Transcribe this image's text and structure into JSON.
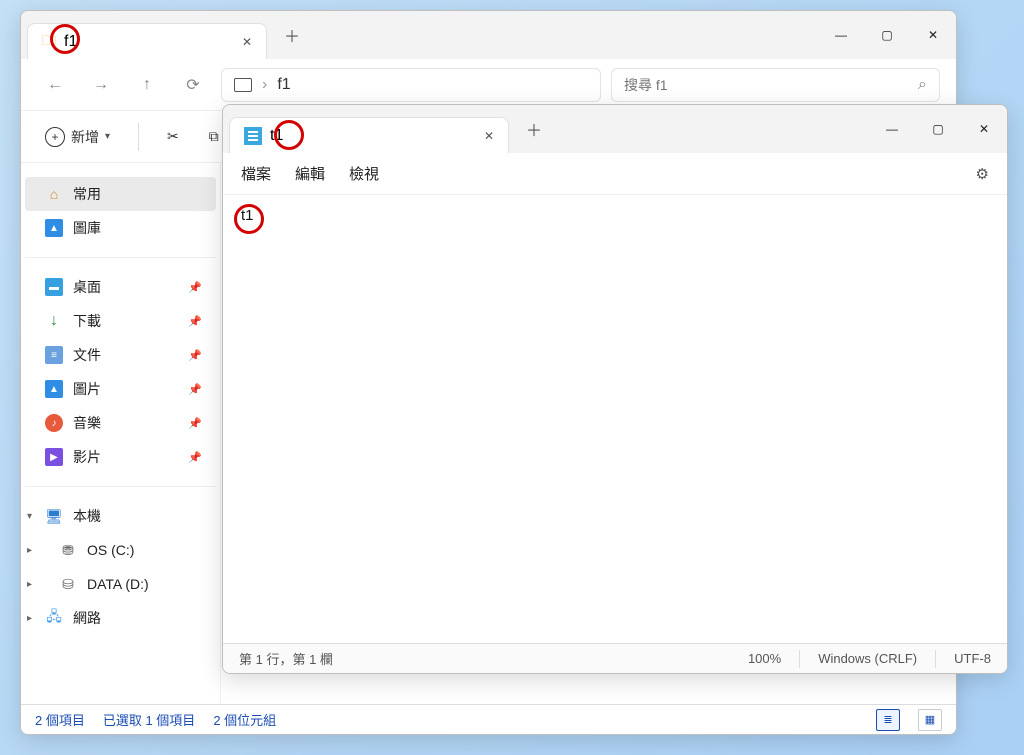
{
  "explorer": {
    "tab_title": "f1",
    "address_text": "f1",
    "search_placeholder": "搜尋 f1",
    "toolbar": {
      "new_label": "新增"
    },
    "sidebar": {
      "home": "常用",
      "gallery": "圖庫",
      "desktop": "桌面",
      "downloads": "下載",
      "documents": "文件",
      "pictures": "圖片",
      "music": "音樂",
      "videos": "影片",
      "this_pc": "本機",
      "drive_c": "OS (C:)",
      "drive_d": "DATA (D:)",
      "network": "網路"
    },
    "status": {
      "item_count": "2 個項目",
      "selection": "已選取 1 個項目",
      "size": "2 個位元組"
    }
  },
  "notepad": {
    "tab_title": "t1",
    "menu": {
      "file": "檔案",
      "edit": "編輯",
      "view": "檢視"
    },
    "content": "t1",
    "status": {
      "position": "第 1 行，第 1 欄",
      "zoom": "100%",
      "line_ending": "Windows (CRLF)",
      "encoding": "UTF-8"
    }
  }
}
